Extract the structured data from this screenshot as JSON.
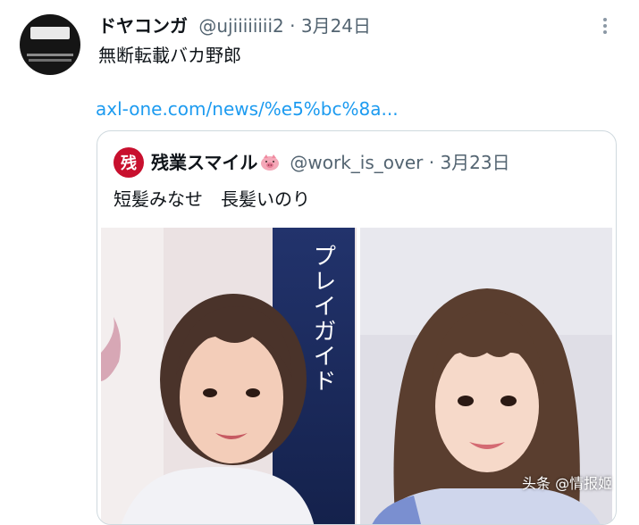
{
  "tweet": {
    "display_name": "ドヤコンガ",
    "meta": "@ujiiiiiiii2 · 3月24日",
    "text": "無断転載バカ野郎",
    "link": "axl-one.com/news/%e5%bc%8a..."
  },
  "quoted": {
    "avatar_char": "残",
    "display_name": "残業スマイル",
    "meta": "@work_is_over · 3月23日",
    "text": "短髪みなせ　長髪いのり",
    "banner_text": "プレイガイド"
  },
  "watermark": "头条 @情报姬",
  "colors": {
    "link": "#1d9bf0",
    "meta": "#536471",
    "border": "#cfd9de",
    "banner": "#1a2a5e"
  }
}
